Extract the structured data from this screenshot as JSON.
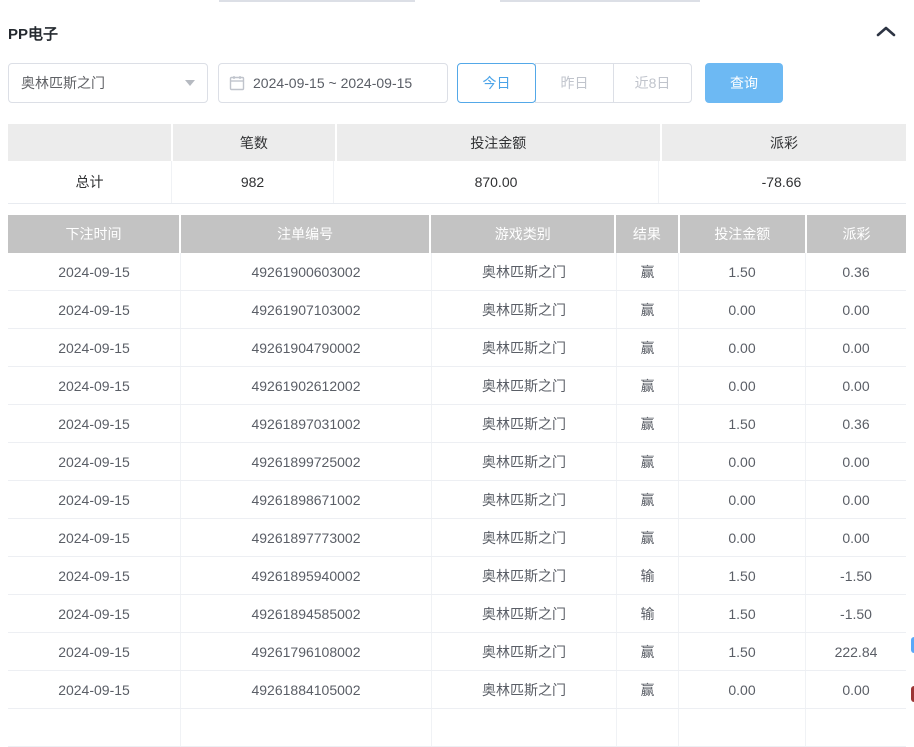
{
  "page": {
    "title": "PP电子"
  },
  "filters": {
    "game_select": {
      "value": "奥林匹斯之门"
    },
    "date_range": {
      "value": "2024-09-15 ~ 2024-09-15"
    },
    "quick_buttons": [
      {
        "label": "今日",
        "active": true
      },
      {
        "label": "昨日",
        "active": false
      },
      {
        "label": "近8日",
        "active": false
      }
    ],
    "search_label": "查询"
  },
  "summary": {
    "columns": [
      "",
      "笔数",
      "投注金额",
      "派彩"
    ],
    "row_label": "总计",
    "count": "982",
    "bet_amount": "870.00",
    "payout": "-78.66"
  },
  "table": {
    "columns": [
      "下注时间",
      "注单编号",
      "游戏类别",
      "结果",
      "投注金额",
      "派彩"
    ],
    "rows": [
      {
        "date": "2024-09-15",
        "order_no": "49261900603002",
        "game": "奥林匹斯之门",
        "result": "赢",
        "bet": "1.50",
        "payout": "0.36"
      },
      {
        "date": "2024-09-15",
        "order_no": "49261907103002",
        "game": "奥林匹斯之门",
        "result": "赢",
        "bet": "0.00",
        "payout": "0.00"
      },
      {
        "date": "2024-09-15",
        "order_no": "49261904790002",
        "game": "奥林匹斯之门",
        "result": "赢",
        "bet": "0.00",
        "payout": "0.00"
      },
      {
        "date": "2024-09-15",
        "order_no": "49261902612002",
        "game": "奥林匹斯之门",
        "result": "赢",
        "bet": "0.00",
        "payout": "0.00"
      },
      {
        "date": "2024-09-15",
        "order_no": "49261897031002",
        "game": "奥林匹斯之门",
        "result": "赢",
        "bet": "1.50",
        "payout": "0.36"
      },
      {
        "date": "2024-09-15",
        "order_no": "49261899725002",
        "game": "奥林匹斯之门",
        "result": "赢",
        "bet": "0.00",
        "payout": "0.00"
      },
      {
        "date": "2024-09-15",
        "order_no": "49261898671002",
        "game": "奥林匹斯之门",
        "result": "赢",
        "bet": "0.00",
        "payout": "0.00"
      },
      {
        "date": "2024-09-15",
        "order_no": "49261897773002",
        "game": "奥林匹斯之门",
        "result": "赢",
        "bet": "0.00",
        "payout": "0.00"
      },
      {
        "date": "2024-09-15",
        "order_no": "49261895940002",
        "game": "奥林匹斯之门",
        "result": "输",
        "bet": "1.50",
        "payout": "-1.50"
      },
      {
        "date": "2024-09-15",
        "order_no": "49261894585002",
        "game": "奥林匹斯之门",
        "result": "输",
        "bet": "1.50",
        "payout": "-1.50"
      },
      {
        "date": "2024-09-15",
        "order_no": "49261796108002",
        "game": "奥林匹斯之门",
        "result": "赢",
        "bet": "1.50",
        "payout": "222.84"
      },
      {
        "date": "2024-09-15",
        "order_no": "49261884105002",
        "game": "奥林匹斯之门",
        "result": "赢",
        "bet": "0.00",
        "payout": "0.00"
      }
    ]
  },
  "icons": {
    "collapse": "chevron-up-icon",
    "select_caret": "chevron-down-icon",
    "calendar": "calendar-icon"
  },
  "colors": {
    "accent_active": "#53a8e8",
    "search_button": "#6db9f3",
    "danger": "#f56c6c",
    "table_header_bg": "#c3c3c3",
    "summary_header_bg": "#ececec"
  }
}
